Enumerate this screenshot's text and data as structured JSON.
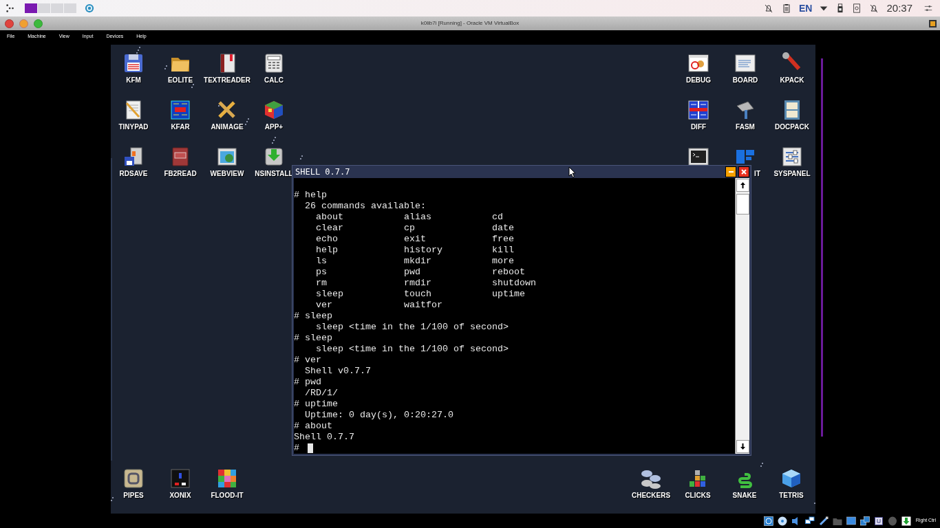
{
  "host_panel": {
    "workspaces": [
      {
        "selected": true
      },
      {
        "selected": false
      },
      {
        "selected": false
      },
      {
        "selected": false
      }
    ],
    "language": "EN",
    "clock": "20:37"
  },
  "window": {
    "title": "k0lib7i [Running] - Oracle VM VirtualBox"
  },
  "menu": [
    "File",
    "Machine",
    "View",
    "Input",
    "Devices",
    "Help"
  ],
  "desktop": {
    "left_icons": [
      {
        "label": "KFM"
      },
      {
        "label": "EOLITE"
      },
      {
        "label": "TEXTREADER"
      },
      {
        "label": "CALC"
      },
      {
        "label": "TINYPAD"
      },
      {
        "label": "KFAR"
      },
      {
        "label": "ANIMAGE"
      },
      {
        "label": "APP+"
      },
      {
        "label": "RDSAVE"
      },
      {
        "label": "FB2READ"
      },
      {
        "label": "WEBVIEW"
      },
      {
        "label": "NSINSTALL"
      }
    ],
    "right_icons": [
      {
        "label": "DEBUG"
      },
      {
        "label": "BOARD"
      },
      {
        "label": "KPACK"
      },
      {
        "label": "DIFF"
      },
      {
        "label": "FASM"
      },
      {
        "label": "DOCPACK"
      },
      {
        "kind": "covered"
      },
      {
        "label": "IT",
        "kind": "clipped"
      },
      {
        "label": "SYSPANEL"
      }
    ],
    "bottom_left_icons": [
      {
        "label": "PIPES"
      },
      {
        "label": "XONIX"
      },
      {
        "label": "FLOOD-IT"
      }
    ],
    "bottom_right_icons": [
      {
        "label": "CHECKERS"
      },
      {
        "label": "CLICKS"
      },
      {
        "label": "SNAKE"
      },
      {
        "label": "TETRIS"
      }
    ]
  },
  "shell": {
    "title": "SHELL 0.7.7",
    "lines": [
      "# help",
      "  26 commands available:",
      "    about           alias           cd",
      "    clear           cp              date",
      "    echo            exit            free",
      "    help            history         kill",
      "    ls              mkdir           more",
      "    ps              pwd             reboot",
      "    rm              rmdir           shutdown",
      "    sleep           touch           uptime",
      "    ver             waitfor",
      "# sleep",
      "    sleep <time in the 1/100 of second>",
      "# sleep",
      "    sleep <time in the 1/100 of second>",
      "# ver",
      "  Shell v0.7.7",
      "# pwd",
      "  /RD/1/",
      "# uptime",
      "  Uptime: 0 day(s), 0:20:27.0",
      "# about",
      "Shell 0.7.7"
    ],
    "prompt": "#"
  },
  "status_bar": {
    "host_key": "Right Ctrl"
  }
}
